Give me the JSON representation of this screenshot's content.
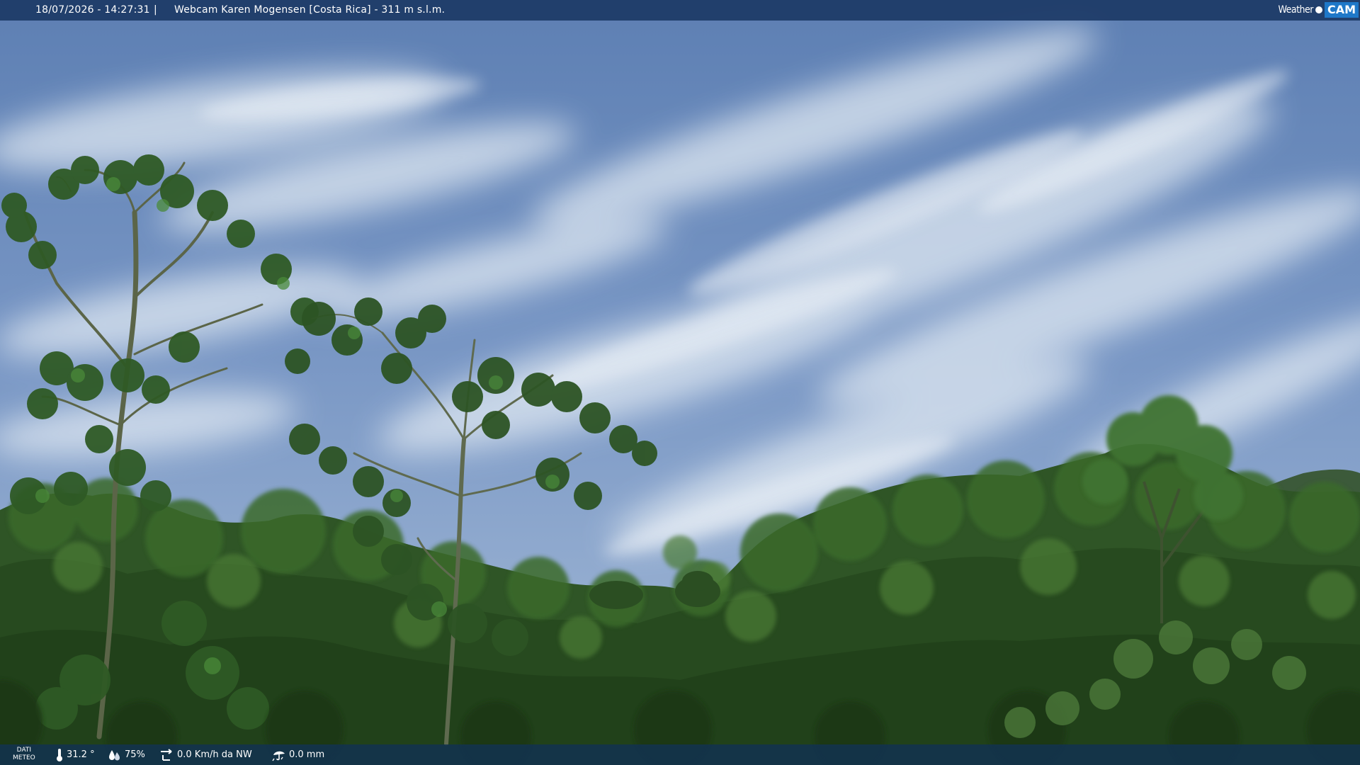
{
  "header": {
    "datetime": "18/07/2026 - 14:27:31",
    "separator": "|",
    "title": "Webcam Karen Mogensen [Costa Rica]  - 311 m s.l.m."
  },
  "logo": {
    "weather_text": "Weather",
    "cam_text": "CAM"
  },
  "footer": {
    "dati_line1": "DATI",
    "dati_line2": "METEO",
    "temperature": "31.2 °",
    "humidity": "75%",
    "wind": "0.0 Km/h da NW",
    "rain": "0.0 mm",
    "icons": [
      "thermometer-icon",
      "humidity-icon",
      "wind-icon",
      "rain-icon"
    ]
  },
  "colors": {
    "topbar": "#1c3a66",
    "bottombar": "#12324e",
    "sky": "#6f8fbf",
    "foliage": "#2e5a24",
    "logo_accent": "#1f78c8"
  }
}
